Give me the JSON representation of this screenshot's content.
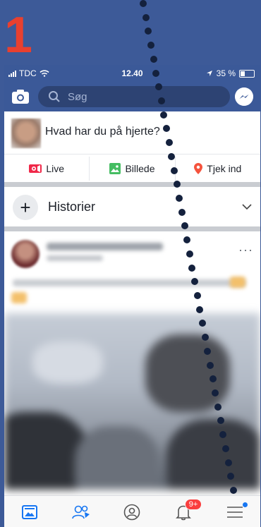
{
  "step_number": "1",
  "status_bar": {
    "carrier": "TDC",
    "time": "12.40",
    "battery": "35 %"
  },
  "search": {
    "placeholder": "Søg"
  },
  "composer": {
    "prompt": "Hvad har du på hjerte?"
  },
  "actions": [
    {
      "label": "Live",
      "icon": "live-video-icon",
      "color": "#f02849"
    },
    {
      "label": "Billede",
      "icon": "photo-icon",
      "color": "#45bd62"
    },
    {
      "label": "Tjek ind",
      "icon": "location-pin-icon",
      "color": "#f5533d"
    }
  ],
  "stories": {
    "label": "Historier"
  },
  "post": {
    "more": "···"
  },
  "tab_bar": {
    "notifications_badge": "9+",
    "items": [
      "news-feed-icon",
      "friends-icon",
      "profile-icon",
      "notifications-icon",
      "menu-icon"
    ]
  },
  "colors": {
    "brand": "#3b5998",
    "page_background": "#3d5a98",
    "step_number": "#e8402f",
    "guide_dots": "#14213d",
    "badge": "#fa3e3e",
    "menu_dot": "#1877f2"
  }
}
